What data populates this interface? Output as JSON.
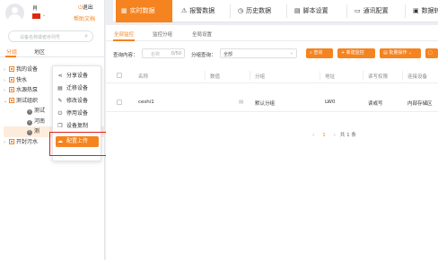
{
  "user": {
    "name": "肖",
    "logout": "退出",
    "help": "帮助文档"
  },
  "sidebar": {
    "search_placeholder": "设备名称或者序列号",
    "tabs": [
      "分组",
      "地区"
    ],
    "tree": [
      {
        "label": "我的设备",
        "arrow": "›"
      },
      {
        "label": "快水",
        "arrow": "›"
      },
      {
        "label": "水源热泵",
        "arrow": "›"
      },
      {
        "label": "测试组织",
        "arrow": "⌄"
      },
      {
        "label": "测试"
      },
      {
        "label": "河南"
      },
      {
        "label": "测"
      },
      {
        "label": "开封污水",
        "arrow": "›"
      }
    ]
  },
  "context_menu": {
    "items": [
      {
        "label": "分享设备",
        "icon": "share-icon"
      },
      {
        "label": "迁移设备",
        "icon": "transfer-icon"
      },
      {
        "label": "修改设备",
        "icon": "edit-icon"
      },
      {
        "label": "停用设备",
        "icon": "power-icon"
      },
      {
        "label": "设备复制",
        "icon": "copy-icon"
      },
      {
        "label": "配置上传",
        "icon": "cloud-upload-icon",
        "highlighted": true
      }
    ]
  },
  "top_tabs": [
    {
      "label": "实时数据",
      "icon": "chart-icon",
      "active": true
    },
    {
      "label": "报警数据",
      "icon": "alert-icon"
    },
    {
      "label": "历史数据",
      "icon": "clock-icon"
    },
    {
      "label": "脚本设置",
      "icon": "script-icon"
    },
    {
      "label": "通讯配置",
      "icon": "monitor-icon"
    },
    {
      "label": "数据转",
      "icon": "data-icon"
    }
  ],
  "sub_tabs": [
    "全部监控",
    "监控分组",
    "全局设置"
  ],
  "filters": {
    "query_label": "查询内容：",
    "query_placeholder": "名称",
    "query_counter": "0/50",
    "group_label": "分组查询：",
    "group_value": "全部",
    "btn_query": "查询",
    "btn_add": "新建监控",
    "btn_batch": "批量操作"
  },
  "table": {
    "headers": [
      "名称",
      "数值",
      "分组",
      "地址",
      "读写权限",
      "连接设备"
    ],
    "rows": [
      {
        "name": "ceshi1",
        "value": "",
        "group": "默认分组",
        "address": "LW0",
        "rw": "读或写",
        "device": "内部存储区"
      }
    ]
  },
  "pagination": {
    "current": "1",
    "total": "共 1 条"
  },
  "colors": {
    "accent": "#f5831f",
    "highlight_box": "#e02020"
  }
}
